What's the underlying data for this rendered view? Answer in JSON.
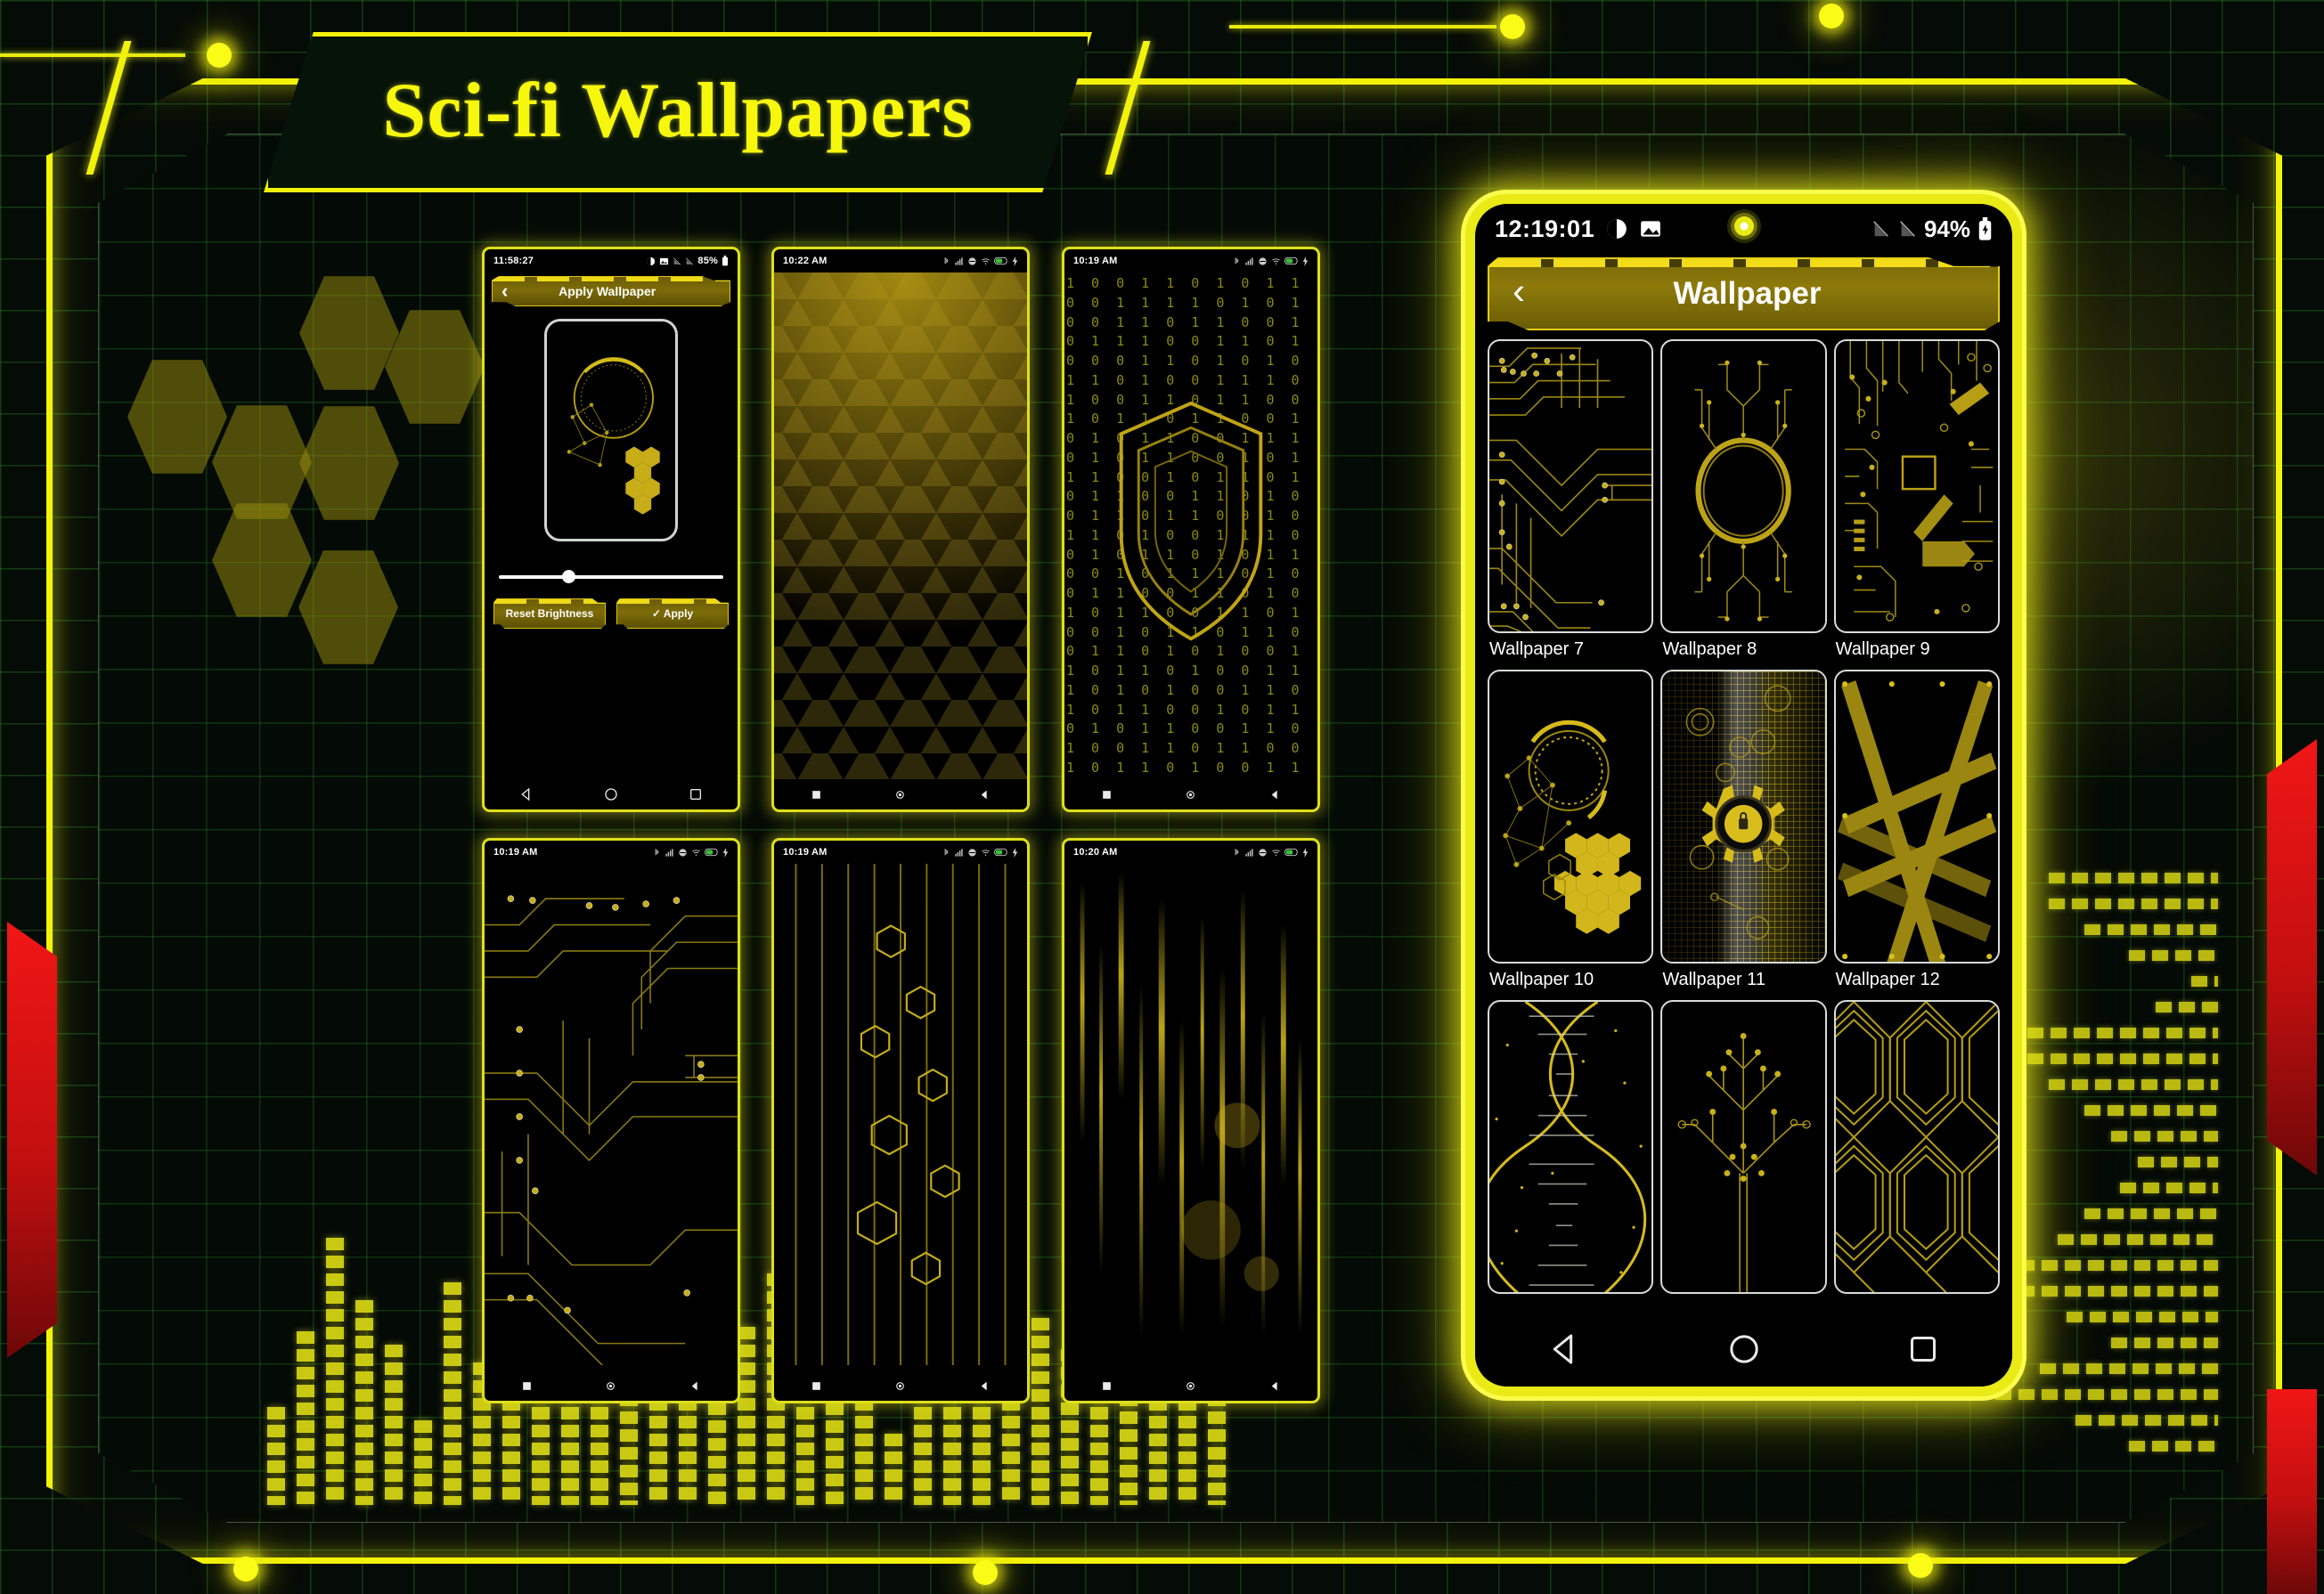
{
  "page": {
    "title": "Sci-fi Wallpapers",
    "accent_yellow": "#f2f20a",
    "accent_gold": "#7d6c08",
    "accent_red": "#d11212",
    "background": "#050b06"
  },
  "big_phone": {
    "status": {
      "time": "12:19:01",
      "battery_percent": "94%",
      "icons": [
        "dnd-icon",
        "image-icon",
        "signal-off-icon",
        "signal-off-icon",
        "battery-icon"
      ]
    },
    "appbar": {
      "back_label": "‹",
      "title": "Wallpaper"
    },
    "wallpapers": [
      {
        "label": "Wallpaper 7",
        "art": "circuit-traces"
      },
      {
        "label": "Wallpaper 8",
        "art": "circuit-ring"
      },
      {
        "label": "Wallpaper 9",
        "art": "circuit-chip"
      },
      {
        "label": "Wallpaper 10",
        "art": "hud-honeycomb"
      },
      {
        "label": "Wallpaper 11",
        "art": "gear-lock-grid"
      },
      {
        "label": "Wallpaper 12",
        "art": "crossing-beams"
      },
      {
        "label": "",
        "art": "dna-helix"
      },
      {
        "label": "",
        "art": "circuit-tree"
      },
      {
        "label": "",
        "art": "hex-maze"
      }
    ],
    "navbar": [
      "back-icon",
      "home-icon",
      "recents-icon"
    ]
  },
  "small_phones": [
    {
      "name": "apply-wallpaper-screen",
      "status": {
        "time": "11:58:27",
        "battery_percent": "85%"
      },
      "appbar": {
        "back_label": "‹",
        "title": "Apply Wallpaper"
      },
      "buttons": [
        {
          "label": "Reset Brightness"
        },
        {
          "label": "✓  Apply"
        }
      ],
      "slider_value": 28,
      "art": "hud-honeycomb"
    },
    {
      "name": "wallpaper-preview-2",
      "status": {
        "time": "10:22 AM"
      },
      "art": "hex-gradient"
    },
    {
      "name": "wallpaper-preview-3",
      "status": {
        "time": "10:19 AM"
      },
      "art": "binary-shield"
    },
    {
      "name": "wallpaper-preview-4",
      "status": {
        "time": "10:19 AM"
      },
      "art": "circuit-traces"
    },
    {
      "name": "wallpaper-preview-5",
      "status": {
        "time": "10:19 AM"
      },
      "art": "hex-bars"
    },
    {
      "name": "wallpaper-preview-6",
      "status": {
        "time": "10:20 AM"
      },
      "art": "light-streaks"
    }
  ],
  "binary_text": "1 0 0 1 1 0 1 0 1 1 0 0 1 1 1 1 0 1 0 1 0 0 1 1 0 1 1 0 0 1 0 1 1 1 0 0 1 1 0 1 0 0 0 1 1 0 1 0 1 0 1 1 0 1 0 0 1 1 1 0 1 0 0 1 1 0 1 1 0 0 1 0 1 1 0 1 1 0 0 1 0 1 0 1 1 0 0 1 1 1 0 1 0 1 1 0 0 1 0 1 1 1 0 0 1 0 1 1 0 1 0 1 1 0 0 1 1 0 1 0 0 1 1 0 1 1 0 0 1 0 1 1 0 1 0 0 1 1 1 0 0 1 0 1 1 0 1 0 1 1 0 0 1 0 1 1 1 0 1 0 0 1 1 0 0 1 1 0 1 0 1 0 1 1 0 0 1 1 0 1 0 0 1 0 1 1 0 1 1 0 0 1 1 0 1 0 1 0 0 1 1 0 1 1 0 1 0 0 1 1 1 0 1 0 1 0 0 1 1 0 1 0 1 1 0 0 1 0 1 1 0 1 0 1 1 0 0 1 1 0 1 0 0 1 1 0 1 1 0 0 1 0 1 1 0 1 0 0 1 1 1 0 0 1 0 1 1 0 1 0 1 1 0 0 1 0 1 1 1 0 1 0 0 1 1 0"
}
